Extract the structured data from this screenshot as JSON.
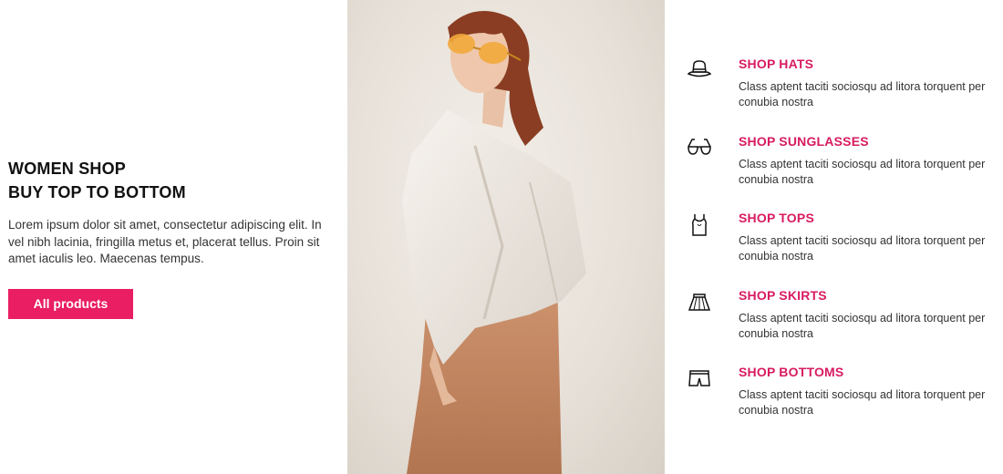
{
  "hero": {
    "title_line1": "WOMEN SHOP",
    "title_line2": "BUY TOP TO BOTTOM",
    "description": "Lorem ipsum dolor sit amet, consectetur adipiscing elit. In vel nibh lacinia, fringilla metus et, placerat tellus. Proin sit amet iaculis leo. Maecenas tempus.",
    "button_label": "All products"
  },
  "colors": {
    "accent": "#e91e63",
    "heading_accent": "#d81b60"
  },
  "features": [
    {
      "icon": "hat-icon",
      "title": "SHOP HATS",
      "text": "Class aptent taciti sociosqu ad litora torquent per conubia nostra"
    },
    {
      "icon": "sunglasses-icon",
      "title": "SHOP SUNGLASSES",
      "text": "Class aptent taciti sociosqu ad litora torquent per conubia nostra"
    },
    {
      "icon": "tank-top-icon",
      "title": "SHOP TOPS",
      "text": "Class aptent taciti sociosqu ad litora torquent per conubia nostra"
    },
    {
      "icon": "skirt-icon",
      "title": "SHOP SKIRTS",
      "text": "Class aptent taciti sociosqu ad litora torquent per conubia nostra"
    },
    {
      "icon": "shorts-icon",
      "title": "SHOP BOTTOMS",
      "text": "Class aptent taciti sociosqu ad litora torquent per conubia nostra"
    }
  ]
}
